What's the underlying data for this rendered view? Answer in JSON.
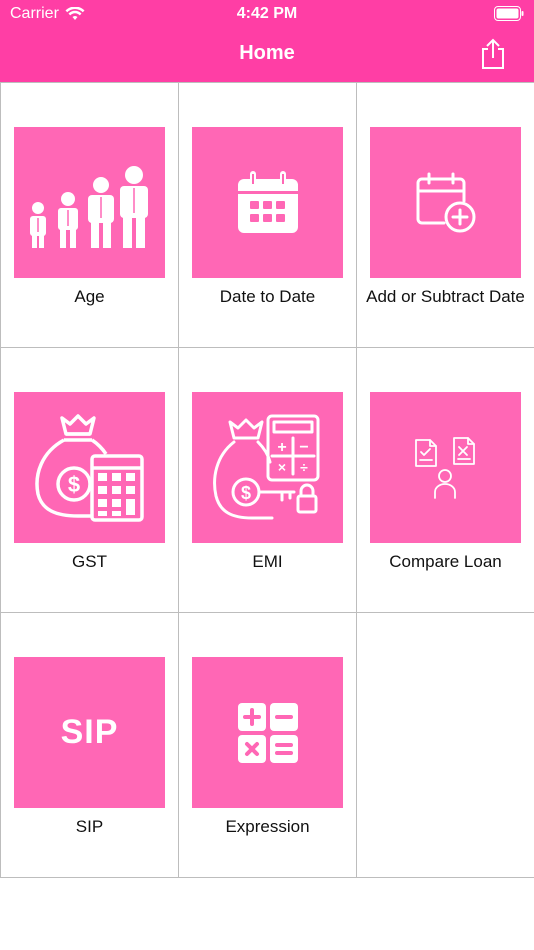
{
  "status_bar": {
    "carrier": "Carrier",
    "time": "4:42 PM"
  },
  "nav": {
    "title": "Home",
    "share_icon": "share-icon"
  },
  "colors": {
    "brand": "#ff3ea5",
    "tile": "#ff67b5"
  },
  "tiles": [
    {
      "label": "Age",
      "icon": "family-icon"
    },
    {
      "label": "Date to Date",
      "icon": "calendar-icon"
    },
    {
      "label": "Add or Subtract Date",
      "icon": "calendar-add-icon"
    },
    {
      "label": "GST",
      "icon": "money-bag-calculator-icon"
    },
    {
      "label": "EMI",
      "icon": "loan-bag-key-icon"
    },
    {
      "label": "Compare Loan",
      "icon": "compare-documents-icon"
    },
    {
      "label": "SIP",
      "icon_text": "SIP"
    },
    {
      "label": "Expression",
      "icon": "math-operators-icon"
    }
  ]
}
